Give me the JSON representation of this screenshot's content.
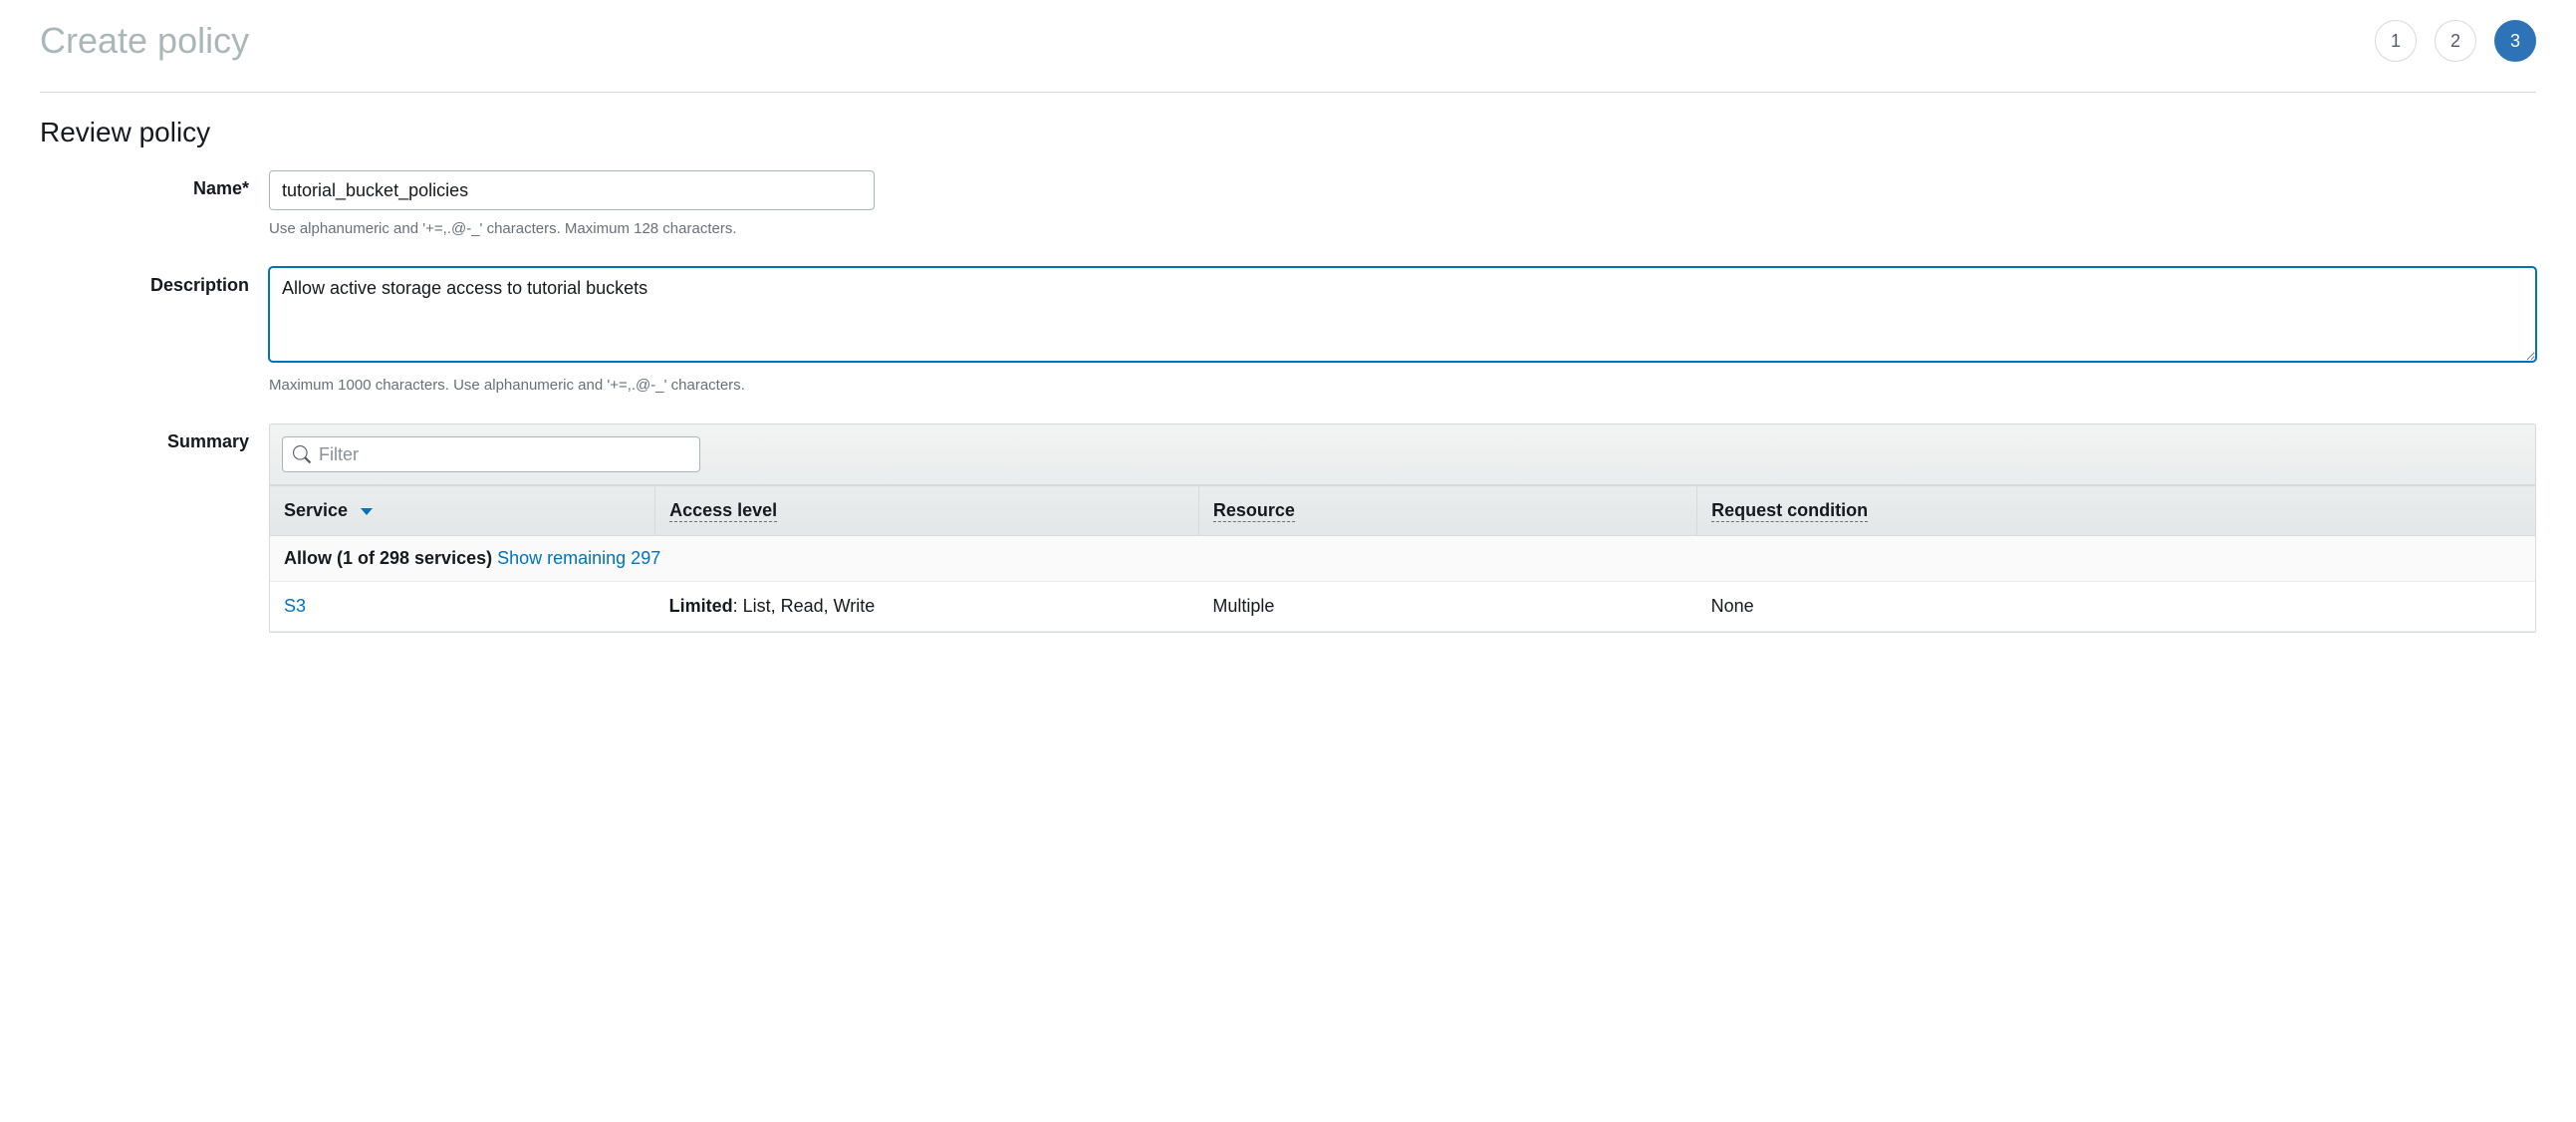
{
  "header": {
    "title": "Create policy",
    "steps": [
      "1",
      "2",
      "3"
    ],
    "active_step_index": 2
  },
  "section_title": "Review policy",
  "form": {
    "name_label": "Name*",
    "name_value": "tutorial_bucket_policies",
    "name_hint": "Use alphanumeric and '+=,.@-_' characters. Maximum 128 characters.",
    "description_label": "Description",
    "description_value": "Allow active storage access to tutorial buckets",
    "description_hint": "Maximum 1000 characters. Use alphanumeric and '+=,.@-_' characters.",
    "summary_label": "Summary"
  },
  "filter": {
    "placeholder": "Filter"
  },
  "table": {
    "columns": {
      "service": "Service",
      "access": "Access level",
      "resource": "Resource",
      "condition": "Request condition"
    },
    "group_label": "Allow (1 of 298 services)",
    "group_link": "Show remaining 297",
    "rows": [
      {
        "service": "S3",
        "access_prefix": "Limited",
        "access_rest": ": List, Read, Write",
        "resource": "Multiple",
        "condition": "None"
      }
    ]
  }
}
